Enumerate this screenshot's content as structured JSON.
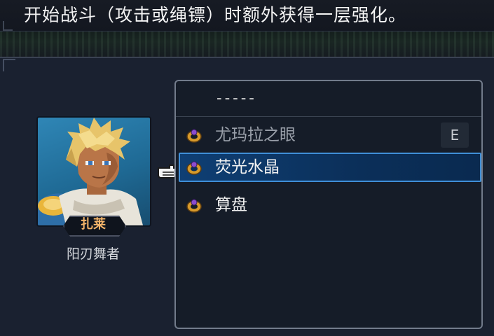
{
  "description": "开始战斗（攻击或绳镖）时额外获得一层强化。",
  "character": {
    "name": "扎莱",
    "class": "阳刃舞者",
    "portrait": "zale-portrait"
  },
  "item_panel": {
    "none_label": "-----",
    "items": [
      {
        "label": "尤玛拉之眼",
        "icon": "ring-icon",
        "state": "equipped",
        "badge": "E"
      },
      {
        "label": "荧光水晶",
        "icon": "ring-icon",
        "state": "selected",
        "badge": ""
      },
      {
        "label": "算盘",
        "icon": "ring-icon",
        "state": "normal",
        "badge": ""
      }
    ]
  },
  "colors": {
    "accent_selected": "#3f8fd8",
    "name_color": "#f3b46a",
    "panel_border": "#727b8b"
  },
  "cursor_icon": "pointing-hand-icon"
}
